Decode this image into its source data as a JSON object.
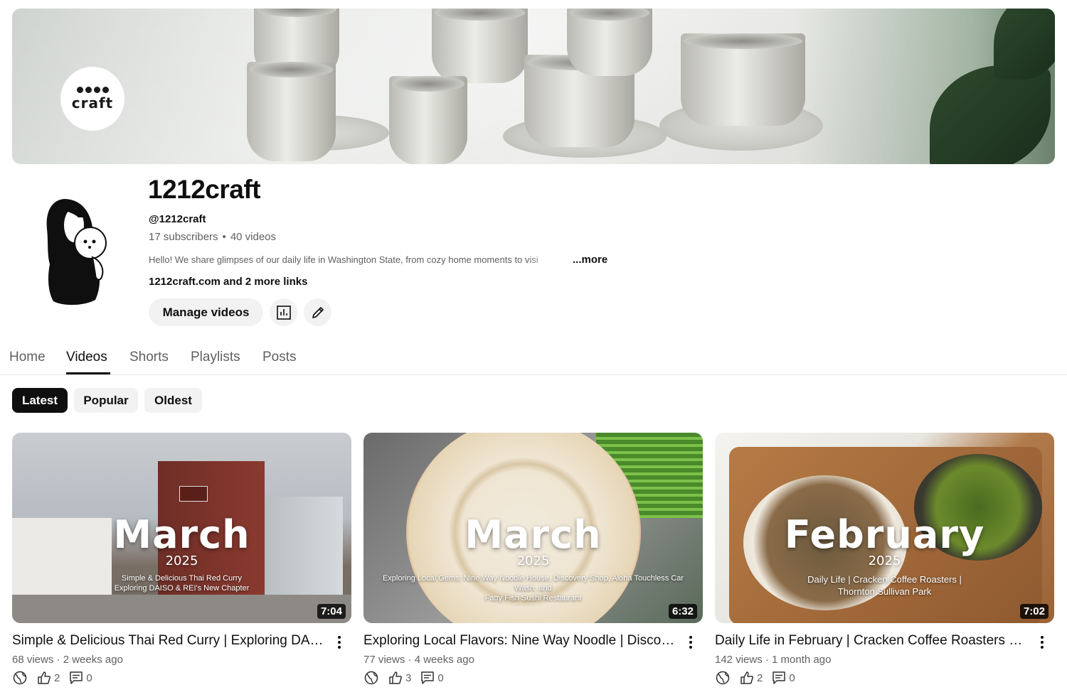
{
  "banner": {
    "logo_text": "craft"
  },
  "channel": {
    "name": "1212craft",
    "handle": "@1212craft",
    "subscribers": "17 subscribers",
    "videos_count": "40 videos",
    "description": "Hello! We share glimpses of our daily life in Washington State, from cozy home moments to visi",
    "more_label": "...more",
    "links": "1212craft.com and 2 more links"
  },
  "actions": {
    "manage_videos": "Manage videos",
    "analytics_icon": "analytics-icon",
    "edit_icon": "pencil-icon"
  },
  "tabs": [
    {
      "label": "Home",
      "active": false
    },
    {
      "label": "Videos",
      "active": true
    },
    {
      "label": "Shorts",
      "active": false
    },
    {
      "label": "Playlists",
      "active": false
    },
    {
      "label": "Posts",
      "active": false
    }
  ],
  "chips": [
    {
      "label": "Latest",
      "active": true
    },
    {
      "label": "Popular",
      "active": false
    },
    {
      "label": "Oldest",
      "active": false
    }
  ],
  "videos": [
    {
      "title": "Simple & Delicious Thai Red Curry | Exploring DAISO & REI's New Chapter",
      "thumb_month": "March",
      "thumb_year": "2025",
      "thumb_sub": "Simple & Delicious Thai Red Curry\nExploring DAISO & REI's New Chapter",
      "duration": "7:04",
      "meta": "68 views · 2 weeks ago",
      "likes": "2",
      "comments": "0"
    },
    {
      "title": "Exploring Local Flavors: Nine Way Noodle | Discovery Shop, Aloha Touchless Car Wash",
      "thumb_month": "March",
      "thumb_year": "2025",
      "thumb_sub": "Exploring Local Gems: Nine Way Noodle House, Discovery Shop, Aloha Touchless Car Wash, and\nFatty Fish Sushi Restaurant",
      "duration": "6:32",
      "meta": "77 views · 4 weeks ago",
      "likes": "3",
      "comments": "0"
    },
    {
      "title": "Daily Life in February | Cracken Coffee Roasters | Thornton Sullivan Park",
      "thumb_month": "February",
      "thumb_year": "2025",
      "thumb_sub": "Daily Life | Cracken Coffee Roasters |\nThornton Sullivan Park",
      "duration": "7:02",
      "meta": "142 views · 1 month ago",
      "likes": "2",
      "comments": "0"
    }
  ],
  "colors": {
    "text_primary": "#0f0f0f",
    "text_secondary": "#606060",
    "chip_bg": "#f2f2f2",
    "chip_active_bg": "#0f0f0f"
  }
}
